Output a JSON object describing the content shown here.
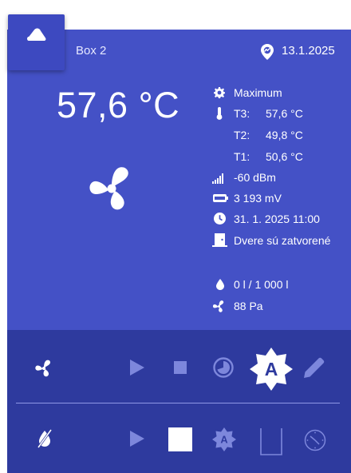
{
  "header": {
    "device_name": "Box 2",
    "date": "13.1.2025",
    "logo_icon": "cloud-icon",
    "location_icon": "location-pin-icon"
  },
  "main": {
    "temperature": "57,6 °C",
    "fan_icon": "fan-icon"
  },
  "info": {
    "mode": "Maximum",
    "sensors": [
      {
        "label": "T3:",
        "value": "57,6 °C"
      },
      {
        "label": "T2:",
        "value": "49,8 °C"
      },
      {
        "label": "T1:",
        "value": "50,6 °C"
      }
    ],
    "signal": "-60 dBm",
    "battery": "3 193 mV",
    "datetime": "31. 1. 2025 11:00",
    "door": "Dvere sú zatvorené",
    "water": "0 l / 1 000 l",
    "pressure": "88 Pa"
  },
  "controls": {
    "fan_row": [
      "fan-icon",
      "play-icon",
      "stop-icon",
      "timer-icon",
      "auto-mode-icon",
      "edit-icon"
    ],
    "water_row": [
      "water-off-icon",
      "play-icon",
      "stop-icon",
      "auto-mode-icon",
      "door-icon",
      "clock-icon"
    ],
    "auto_badge": "A"
  },
  "colors": {
    "panel": "#4451c6",
    "controls_panel": "#2e3a9e",
    "text": "#ffffff"
  }
}
